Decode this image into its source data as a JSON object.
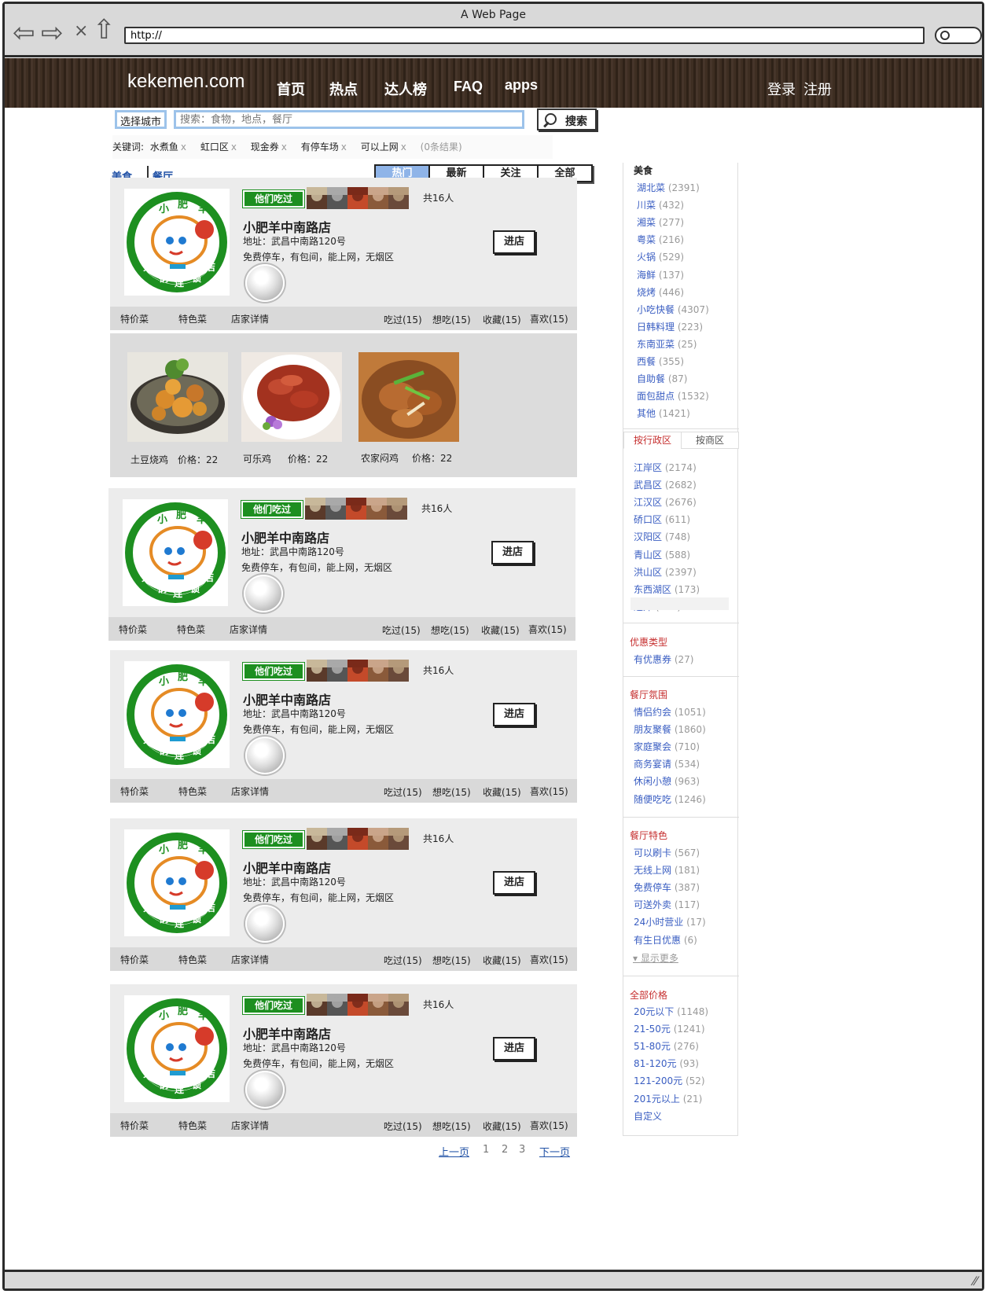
{
  "window_title": "A Web Page",
  "address": "http://",
  "site": {
    "logo": "kekemen.com",
    "nav": [
      "首页",
      "热点",
      "达人榜",
      "FAQ",
      "apps"
    ],
    "login": "登录",
    "register": "注册"
  },
  "search": {
    "city": "选择城市",
    "query_placeholder": "搜索：食物，地点，餐厅",
    "button": "搜索"
  },
  "filters": {
    "label": "关键词:",
    "items": [
      "水煮鱼",
      "虹口区",
      "现金券",
      "有停车场",
      "可以上网"
    ],
    "result": "(0条结果)"
  },
  "category_tabs": [
    "美食",
    "餐厅"
  ],
  "sort_tabs": [
    "热门",
    "最新",
    "关注",
    "全部"
  ],
  "colors": {
    "accent_blue": "#8fb4e8",
    "badge_green": "#1d8f20",
    "header_brown": "#3e2e22",
    "sidebar_red": "#c62f2f"
  },
  "restaurants": [
    {
      "badge": "他们吃过",
      "count": "共16人",
      "name": "小肥羊中南路店",
      "address": "地址：武昌中南路120号",
      "features": "免费停车，有包间，能上网，无烟区",
      "enter": "进店",
      "links": [
        "特价菜",
        "特色菜",
        "店家详情"
      ],
      "stats": [
        "吃过(15)",
        "想吃(15)",
        "收藏(15)",
        "喜欢(15)"
      ]
    },
    {
      "badge": "他们吃过",
      "count": "共16人",
      "name": "小肥羊中南路店",
      "address": "地址：武昌中南路120号",
      "features": "免费停车，有包间，能上网，无烟区",
      "enter": "进店",
      "links": [
        "特价菜",
        "特色菜",
        "店家详情"
      ],
      "stats": [
        "吃过(15)",
        "想吃(15)",
        "收藏(15)",
        "喜欢(15)"
      ]
    },
    {
      "badge": "他们吃过",
      "count": "共16人",
      "name": "小肥羊中南路店",
      "address": "地址：武昌中南路120号",
      "features": "免费停车，有包间，能上网，无烟区",
      "enter": "进店",
      "links": [
        "特价菜",
        "特色菜",
        "店家详情"
      ],
      "stats": [
        "吃过(15)",
        "想吃(15)",
        "收藏(15)",
        "喜欢(15)"
      ]
    },
    {
      "badge": "他们吃过",
      "count": "共16人",
      "name": "小肥羊中南路店",
      "address": "地址：武昌中南路120号",
      "features": "免费停车，有包间，能上网，无烟区",
      "enter": "进店",
      "links": [
        "特价菜",
        "特色菜",
        "店家详情"
      ],
      "stats": [
        "吃过(15)",
        "想吃(15)",
        "收藏(15)",
        "喜欢(15)"
      ]
    },
    {
      "badge": "他们吃过",
      "count": "共16人",
      "name": "小肥羊中南路店",
      "address": "地址：武昌中南路120号",
      "features": "免费停车，有包间，能上网，无烟区",
      "enter": "进店",
      "links": [
        "特价菜",
        "特色菜",
        "店家详情"
      ],
      "stats": [
        "吃过(15)",
        "想吃(15)",
        "收藏(15)",
        "喜欢(15)"
      ]
    }
  ],
  "logo_text": {
    "top": [
      "小",
      "肥",
      "羊"
    ],
    "bottom": [
      "火",
      "锅",
      "连",
      "锁",
      "店"
    ]
  },
  "dishes": [
    {
      "name": "土豆烧鸡",
      "price": "价格：22"
    },
    {
      "name": "可乐鸡",
      "price": "价格：22"
    },
    {
      "name": "农家闷鸡",
      "price": "价格：22"
    }
  ],
  "pagination": {
    "prev": "上一页",
    "pages": [
      "1",
      "2",
      "3"
    ],
    "next": "下一页"
  },
  "sidebar": {
    "cuisine_title": "美食",
    "cuisines": [
      {
        "name": "湖北菜",
        "count": "(2391)"
      },
      {
        "name": "川菜",
        "count": "(432)"
      },
      {
        "name": "湘菜",
        "count": "(277)"
      },
      {
        "name": "粤菜",
        "count": "(216)"
      },
      {
        "name": "火锅",
        "count": "(529)"
      },
      {
        "name": "海鲜",
        "count": "(137)"
      },
      {
        "name": "烧烤",
        "count": "(446)"
      },
      {
        "name": "小吃快餐",
        "count": "(4307)"
      },
      {
        "name": "日韩料理",
        "count": "(223)"
      },
      {
        "name": "东南亚菜",
        "count": "(25)"
      },
      {
        "name": "西餐",
        "count": "(355)"
      },
      {
        "name": "自助餐",
        "count": "(87)"
      },
      {
        "name": "面包甜点",
        "count": "(1532)"
      },
      {
        "name": "其他",
        "count": "(1421)"
      }
    ],
    "area_tabs": [
      "按行政区",
      "按商区"
    ],
    "districts": [
      {
        "name": "江岸区",
        "count": "(2174)"
      },
      {
        "name": "武昌区",
        "count": "(2682)"
      },
      {
        "name": "江汉区",
        "count": "(2676)"
      },
      {
        "name": "硚口区",
        "count": "(611)"
      },
      {
        "name": "汉阳区",
        "count": "(748)"
      },
      {
        "name": "青山区",
        "count": "(588)"
      },
      {
        "name": "洪山区",
        "count": "(2397)"
      },
      {
        "name": "东西湖区",
        "count": "(173)"
      },
      {
        "name": "近郊",
        "count": "(262)"
      }
    ],
    "discount_title": "优惠类型",
    "discounts": [
      {
        "name": "有优惠券",
        "count": "(27)"
      }
    ],
    "atmosphere_title": "餐厅氛围",
    "atmospheres": [
      {
        "name": "情侣约会",
        "count": "(1051)"
      },
      {
        "name": "朋友聚餐",
        "count": "(1860)"
      },
      {
        "name": "家庭聚会",
        "count": "(710)"
      },
      {
        "name": "商务宴请",
        "count": "(534)"
      },
      {
        "name": "休闲小憩",
        "count": "(963)"
      },
      {
        "name": "随便吃吃",
        "count": "(1246)"
      }
    ],
    "feature_title": "餐厅特色",
    "features": [
      {
        "name": "可以刷卡",
        "count": "(567)"
      },
      {
        "name": "无线上网",
        "count": "(181)"
      },
      {
        "name": "免费停车",
        "count": "(387)"
      },
      {
        "name": "可送外卖",
        "count": "(117)"
      },
      {
        "name": "24小时营业",
        "count": "(17)"
      },
      {
        "name": "有生日优惠",
        "count": "(6)"
      }
    ],
    "show_more": "显示更多",
    "price_title": "全部价格",
    "prices": [
      {
        "name": "20元以下",
        "count": "(1148)"
      },
      {
        "name": "21-50元",
        "count": "(1241)"
      },
      {
        "name": "51-80元",
        "count": "(276)"
      },
      {
        "name": "81-120元",
        "count": "(93)"
      },
      {
        "name": "121-200元",
        "count": "(52)"
      },
      {
        "name": "201元以上",
        "count": "(21)"
      },
      {
        "name": "自定义",
        "count": ""
      }
    ]
  }
}
